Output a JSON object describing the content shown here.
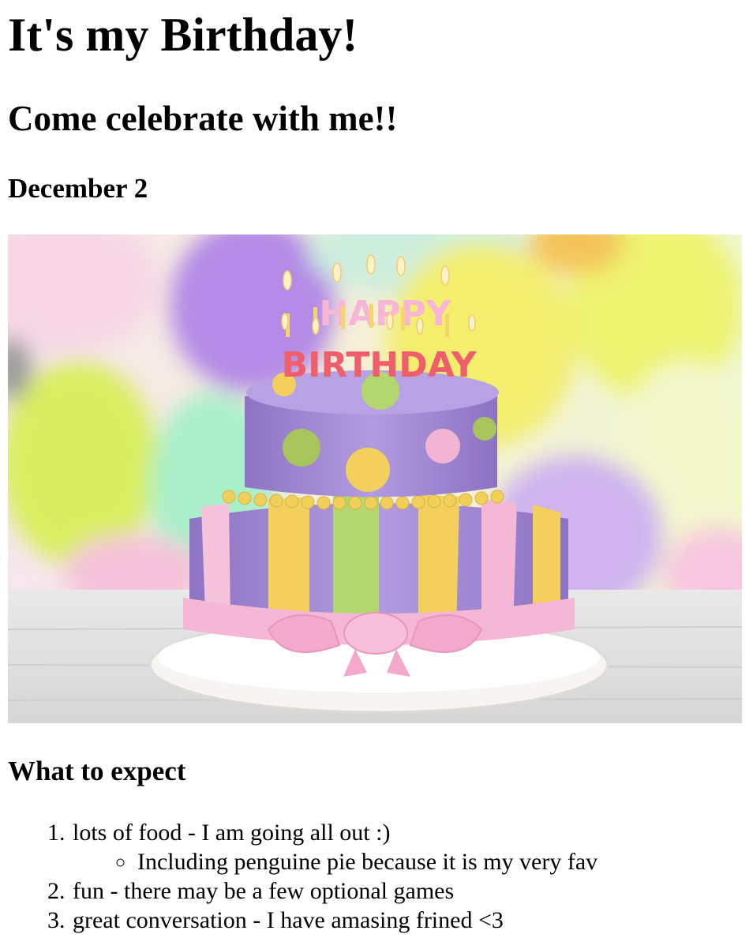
{
  "heading": "It's my Birthday!",
  "subheading": "Come celebrate with me!!",
  "date": "December 2",
  "hero_image": {
    "name": "birthday-cake-photo",
    "topper_line1": "HAPPY",
    "topper_line2": "BIRTHDAY"
  },
  "expect_heading": "What to expect",
  "expect_items": [
    "lots of food - I am going all out :)",
    "fun - there may be a few optional games",
    "great conversation - I have amasing frined <3"
  ],
  "expect_subitem": "Including penguine pie because it is my very fav",
  "colors": {
    "cake_purple": "#a38ad0",
    "ribbon_pink": "#f4b8d6",
    "stripe_yellow": "#f3cf5e",
    "stripe_green": "#b3d66e",
    "balloon_yellow": "#f2f26e",
    "balloon_purple": "#b48ae6"
  }
}
